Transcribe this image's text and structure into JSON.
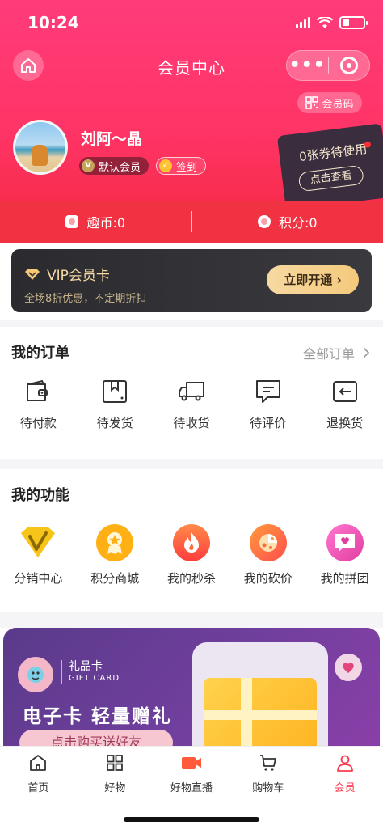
{
  "status_bar": {
    "time": "10:24"
  },
  "nav": {
    "title": "会员中心",
    "more": "•••"
  },
  "member_code_label": "会员码",
  "user": {
    "name": "刘阿～晶",
    "level": "默认会员",
    "level_icon": "V",
    "checkin": "签到",
    "checkin_icon": "✓"
  },
  "coupon": {
    "text": "0张券待使用",
    "button": "点击查看"
  },
  "points": {
    "coins": "趣币:0",
    "score": "积分:0"
  },
  "vip": {
    "title": "VIP会员卡",
    "subtitle": "全场8折优惠，不定期折扣",
    "button": "立即开通 ›"
  },
  "orders": {
    "title": "我的订单",
    "all_label": "全部订单",
    "items": [
      {
        "label": "待付款",
        "icon": "wallet-icon"
      },
      {
        "label": "待发货",
        "icon": "package-icon"
      },
      {
        "label": "待收货",
        "icon": "truck-icon"
      },
      {
        "label": "待评价",
        "icon": "comment-icon"
      },
      {
        "label": "退换货",
        "icon": "return-icon"
      }
    ]
  },
  "functions": {
    "title": "我的功能",
    "items": [
      {
        "label": "分销中心",
        "icon": "distribution-icon",
        "color": "#f7c419"
      },
      {
        "label": "积分商城",
        "icon": "points-mall-icon",
        "color": "#ffb014"
      },
      {
        "label": "我的秒杀",
        "icon": "flash-sale-icon",
        "color": "#ff5a3c"
      },
      {
        "label": "我的砍价",
        "icon": "bargain-icon",
        "color": "#ff6a3a"
      },
      {
        "label": "我的拼团",
        "icon": "group-buy-icon",
        "color": "#ff4fa8"
      }
    ]
  },
  "banner": {
    "card_label": "礼品卡",
    "card_sub": "GIFT CARD",
    "headline": "电子卡  轻量赠礼",
    "cta": "点击购买送好友"
  },
  "tabbar": [
    {
      "label": "首页",
      "icon": "home-icon"
    },
    {
      "label": "好物",
      "icon": "grid-icon"
    },
    {
      "label": "好物直播",
      "icon": "live-video-icon"
    },
    {
      "label": "购物车",
      "icon": "cart-icon"
    },
    {
      "label": "会员",
      "icon": "member-icon"
    }
  ],
  "colors": {
    "primary": "#ff3466",
    "accent": "#ff3a4f",
    "vip_gold": "#f6d9a3"
  }
}
